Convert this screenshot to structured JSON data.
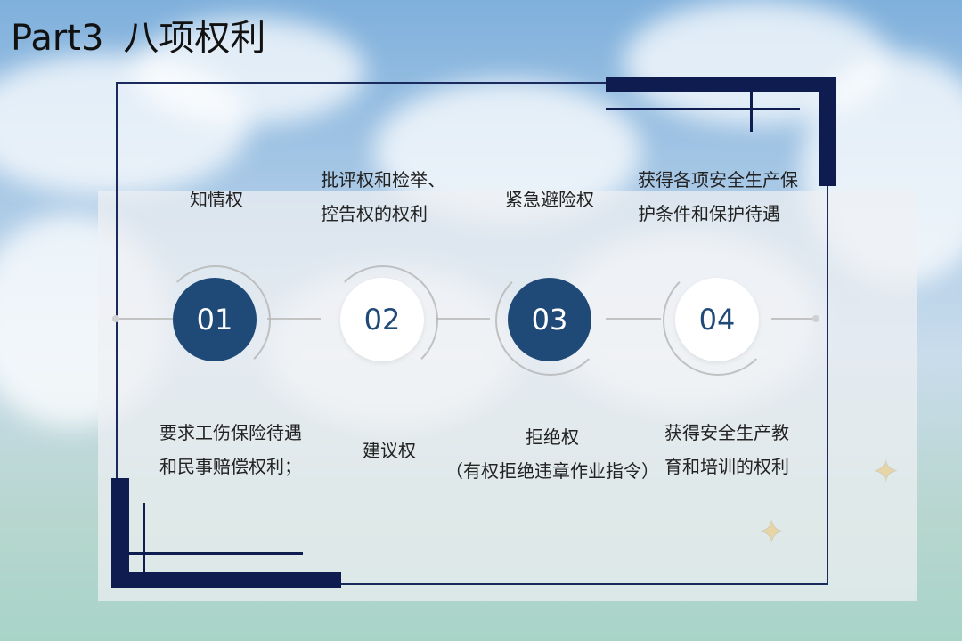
{
  "title": {
    "part": "Part3",
    "heading": "八项权利"
  },
  "top_items": [
    {
      "lines": [
        "知情权"
      ]
    },
    {
      "lines": [
        "批评权和检举、",
        "控告权的权利"
      ]
    },
    {
      "lines": [
        "紧急避险权"
      ]
    },
    {
      "lines": [
        "获得各项安全生产保",
        "护条件和保护待遇"
      ]
    }
  ],
  "numbers": [
    "01",
    "02",
    "03",
    "04"
  ],
  "bottom_items": [
    {
      "lines": [
        "要求工伤保险待遇",
        "和民事赔偿权利；"
      ]
    },
    {
      "lines": [
        "建议权"
      ]
    },
    {
      "lines": [
        "拒绝权",
        "（有权拒绝违章作业指令）"
      ]
    },
    {
      "lines": [
        "获得安全生产教",
        "育和培训的权利"
      ]
    }
  ],
  "colors": {
    "frame": "#0f1c50",
    "circle_dark": "#1f4a78",
    "circle_light": "#ffffff"
  }
}
